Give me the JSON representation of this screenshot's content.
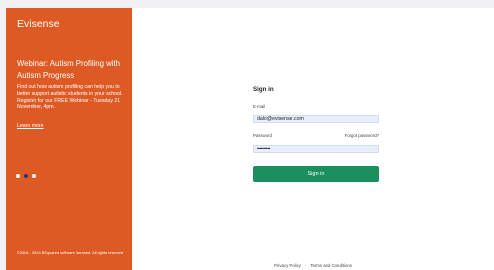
{
  "sidebar": {
    "brand": "Evisense",
    "webinar_title": "Webinar: Autism Profiling with Autism Progress",
    "webinar_description": "Find out how autism profiling can help you to better support autistic students in your school. Register for our FREE Webinar - Tuesday 21 November, 4pm.",
    "learn_more": "Learn more",
    "carousel": {
      "count": 3,
      "active_index": 1,
      "active_color": "#1f3d7a",
      "dot_color": "#ffffff"
    },
    "copyright": "©2004 - 2024 BSquared software licensed. All rights reserved",
    "background_color": "#dd5a24"
  },
  "signin": {
    "title": "Sign in",
    "email_label": "E-mail",
    "email_value": "dalo@evisense.com",
    "password_label": "Password",
    "forgot_link": "Forgot password?",
    "password_value": "••••••••••",
    "button_label": "Sign in",
    "button_color": "#1b8f5d"
  },
  "footer": {
    "privacy_link": "Privacy Policy",
    "separator": "·",
    "terms_link": "Terms and Conditions"
  }
}
